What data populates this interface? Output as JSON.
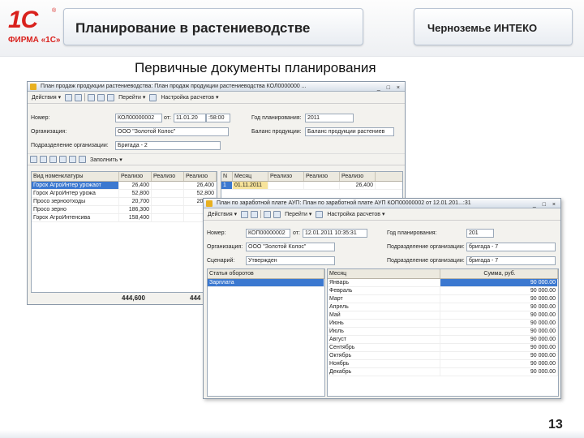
{
  "header": {
    "logo_text": "1С",
    "logo_firm": "ФИРМА «1С»",
    "logo_reg": "®",
    "title": "Планирование в растениеводстве",
    "org": "Черноземье ИНТЕКО"
  },
  "subtitle": "Первичные документы планирования",
  "page_number": "13",
  "win1": {
    "title": "План продаж продукции растениеводства: План продаж продукции растениеводства КОЛ0000000 ...",
    "controls": "_ □ ×",
    "toolbar": {
      "actions": "Действия ▾",
      "go": "Перейти ▾",
      "settings": "Настройка расчетов ▾"
    },
    "number_label": "Номер:",
    "number_value": "КОЛ00000002",
    "from_label": "от:",
    "date_value": "11.01.20",
    "time_value": ":58:00",
    "year_label": "Год планирования:",
    "year_value": "2011",
    "org_label": "Организация:",
    "org_value": "ООО \"Золотой Колос\"",
    "balance_label": "Баланс продукции:",
    "balance_value": "Баланс продукции растениев",
    "dept_label": "Подразделение организации:",
    "dept_value": "Бригада - 2",
    "fill_label": "Заполнить ▾",
    "columns_left": [
      "Вид номенклатуры",
      "Реализо",
      "Реализо",
      "Реализо"
    ],
    "columns_right": [
      "N",
      "Месяц",
      "Реализо",
      "Реализо",
      "Реализо"
    ],
    "rows": [
      [
        "Горох АгроИнтер урожаот",
        "26,400",
        "",
        "26,400"
      ],
      [
        "Горох АгроИнтер урожа",
        "52,800",
        "",
        "52,800"
      ],
      [
        "Просо зерноотходы",
        "20,700",
        "",
        "20,700"
      ],
      [
        "Просо зерно",
        "186,300",
        "",
        "186"
      ],
      [
        "Горох АгроИнтенсива",
        "158,400",
        "",
        "158"
      ]
    ],
    "right_row": [
      "1",
      "01.11.2011",
      "",
      "",
      "26,400"
    ],
    "total_left": "444,600",
    "total_mid": "444"
  },
  "win2": {
    "title": "План по заработной плате АУП: План по заработной плате АУП КОП00000002 от 12.01.201...:31",
    "controls": "_ □ ×",
    "toolbar": {
      "actions": "Действия ▾",
      "go": "Перейти ▾",
      "settings": "Настройка расчетов ▾"
    },
    "number_label": "Номер:",
    "number_value": "КОП00000002",
    "from_label": "от:",
    "date_value": "12.01.2011 10:35:31",
    "year_label": "Год планирования:",
    "year_value": "201",
    "org_label": "Организация:",
    "org_value": "ООО \"Золотой Колос\"",
    "dept1_label": "Подразделение организации:",
    "dept1_value": "бригада - 7",
    "scenario_label": "Сценарий:",
    "scenario_value": "Утвержден",
    "dept2_label": "Подразделение организации:",
    "dept2_value": "бригада - 7",
    "left_header": "Статья оборотов",
    "left_item": "Зарплата",
    "col_month": "Месяц",
    "col_sum": "Сумма, руб.",
    "months": [
      {
        "m": "Январь",
        "v": "90 000.00"
      },
      {
        "m": "Февраль",
        "v": "90 000.00"
      },
      {
        "m": "Март",
        "v": "90 000.00"
      },
      {
        "m": "Апрель",
        "v": "90 000.00"
      },
      {
        "m": "Май",
        "v": "90 000.00"
      },
      {
        "m": "Июнь",
        "v": "90 000.00"
      },
      {
        "m": "Июль",
        "v": "90 000.00"
      },
      {
        "m": "Август",
        "v": "90 000.00"
      },
      {
        "m": "Сентябрь",
        "v": "90 000.00"
      },
      {
        "m": "Октябрь",
        "v": "90 000.00"
      },
      {
        "m": "Ноябрь",
        "v": "90 000.00"
      },
      {
        "m": "Декабрь",
        "v": "90 000.00"
      }
    ]
  }
}
